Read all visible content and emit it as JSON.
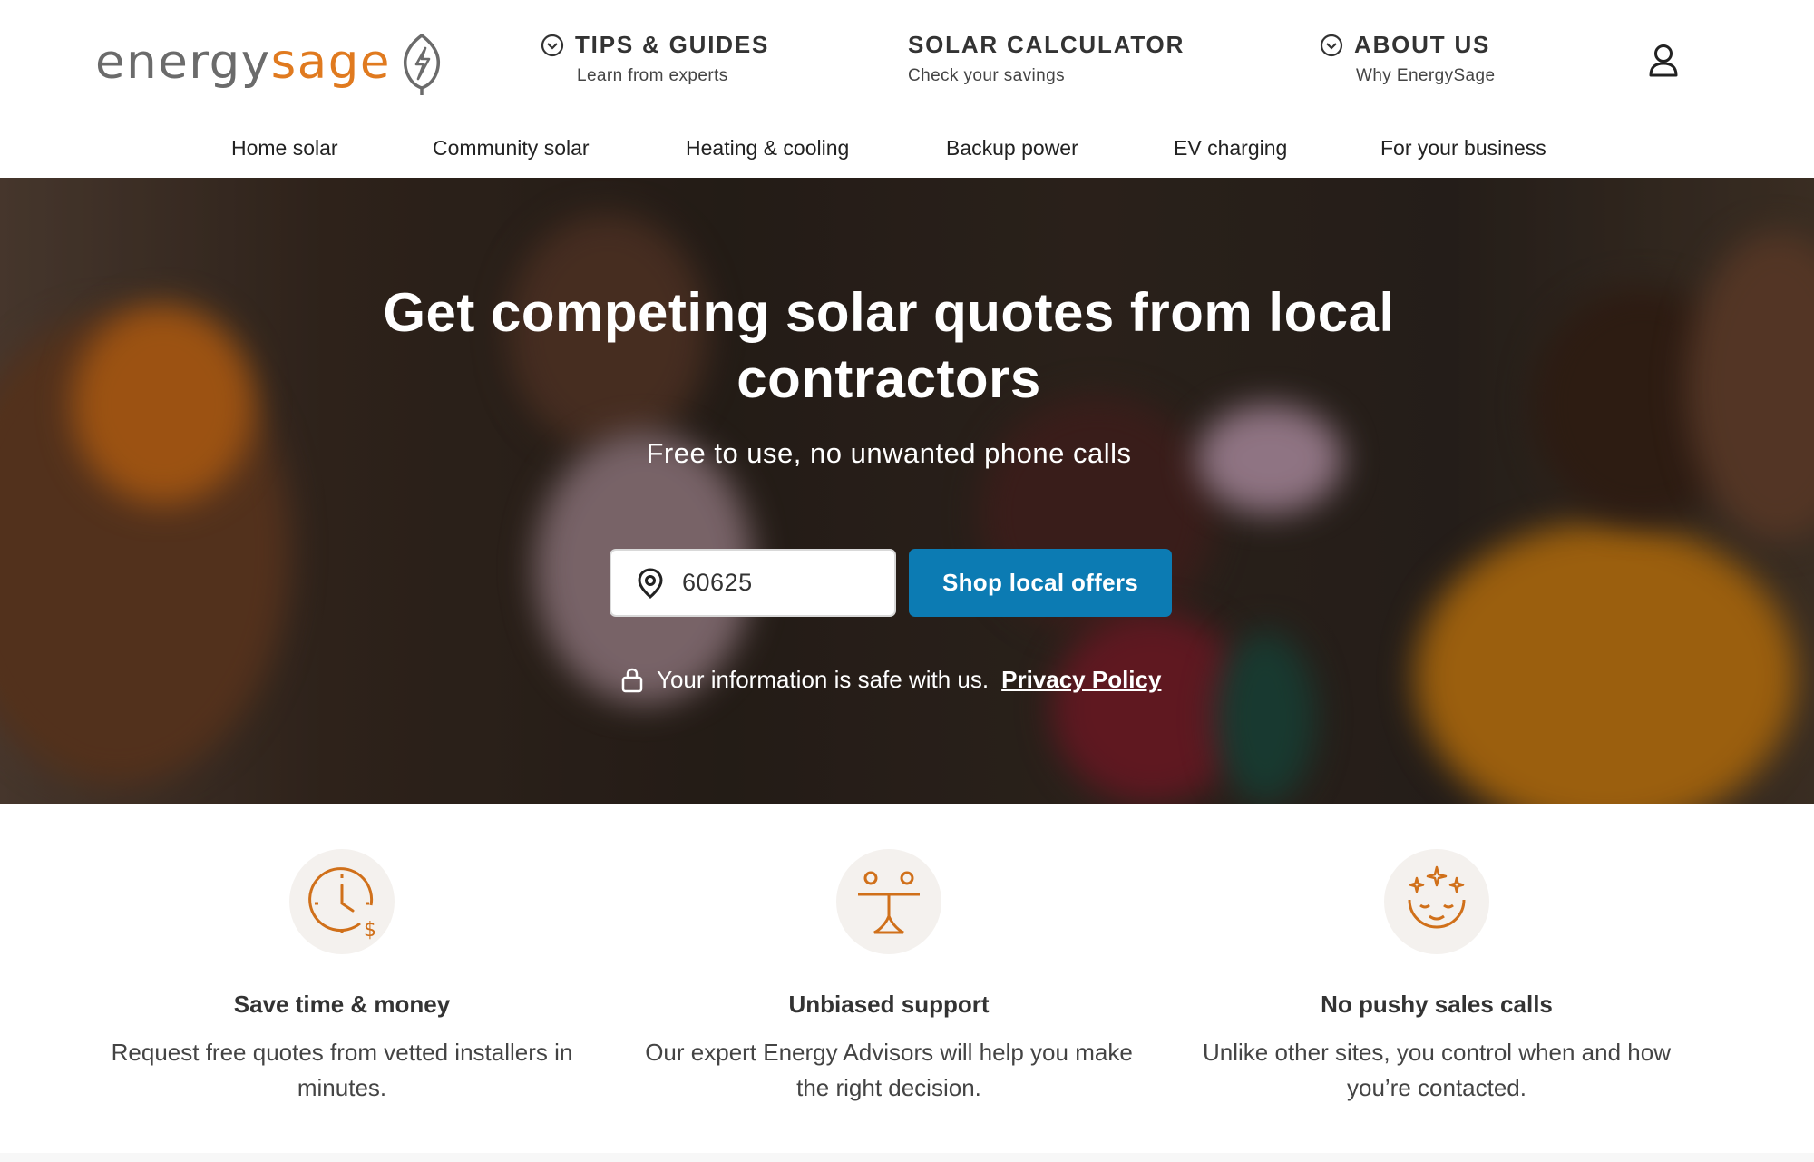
{
  "brand": {
    "name_part1": "energy",
    "name_part2": "sage",
    "accent": "#e07a1f",
    "logo_icon": "leaf-lightning-icon"
  },
  "header": {
    "tips": {
      "label": "TIPS & GUIDES",
      "sub": "Learn from experts",
      "icon": "chevron-circle-icon"
    },
    "calculator": {
      "label": "SOLAR CALCULATOR",
      "sub": "Check your savings"
    },
    "about": {
      "label": "ABOUT US",
      "sub": "Why EnergySage",
      "icon": "chevron-circle-icon"
    },
    "account_icon": "user-icon"
  },
  "subnav": [
    "Home solar",
    "Community solar",
    "Heating & cooling",
    "Backup power",
    "EV charging",
    "For your business"
  ],
  "hero": {
    "title": "Get competing solar quotes from local contractors",
    "tagline": "Free to use, no unwanted phone calls",
    "zip_value": "60625",
    "zip_icon": "location-pin-icon",
    "cta": "Shop local offers",
    "cta_color": "#0c7bb3",
    "privacy_text": "Your information is safe with us.",
    "privacy_link": "Privacy Policy",
    "privacy_icon": "lock-icon"
  },
  "features": [
    {
      "icon": "clock-dollar-icon",
      "title": "Save time & money",
      "text": "Request free quotes from vetted installers in minutes."
    },
    {
      "icon": "balance-scale-icon",
      "title": "Unbiased support",
      "text": "Our expert Energy Advisors will help you make the right decision."
    },
    {
      "icon": "calm-face-sparkles-icon",
      "title": "No pushy sales calls",
      "text": "Unlike other sites, you control when and how you’re contacted."
    }
  ]
}
